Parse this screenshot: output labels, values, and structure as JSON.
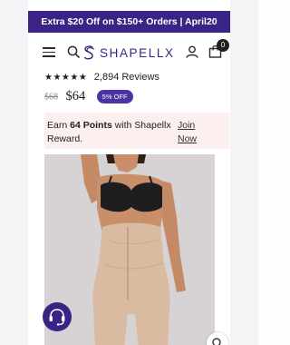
{
  "promo_banner": {
    "text": "Extra $20 Off on $150+ Orders | April20"
  },
  "header": {
    "brand": "SHAPELLX",
    "cart_count": "0",
    "icons": [
      "menu-icon",
      "search-icon",
      "user-icon",
      "shopping-bag-icon"
    ]
  },
  "product": {
    "rating_stars": "★★★★★",
    "rating": 5,
    "reviews_label": "2,894 Reviews",
    "old_price": "$68",
    "price": "$64",
    "discount_badge": "5% OFF"
  },
  "rewards": {
    "prefix": "Earn",
    "points": "64 Points",
    "suffix": "with Shapellx Reward.",
    "join_label": "Join Now"
  },
  "colors": {
    "brand_purple": "#3a2385",
    "badge_purple": "#4c33a3",
    "rewards_bg": "#fbf0ee",
    "skin": "#c98f6b",
    "shapewear": "#d8bba0",
    "bra": "#1e1e20"
  },
  "floating": {
    "chat_icon": "headset-icon",
    "zoom_icon": "zoom-icon"
  }
}
